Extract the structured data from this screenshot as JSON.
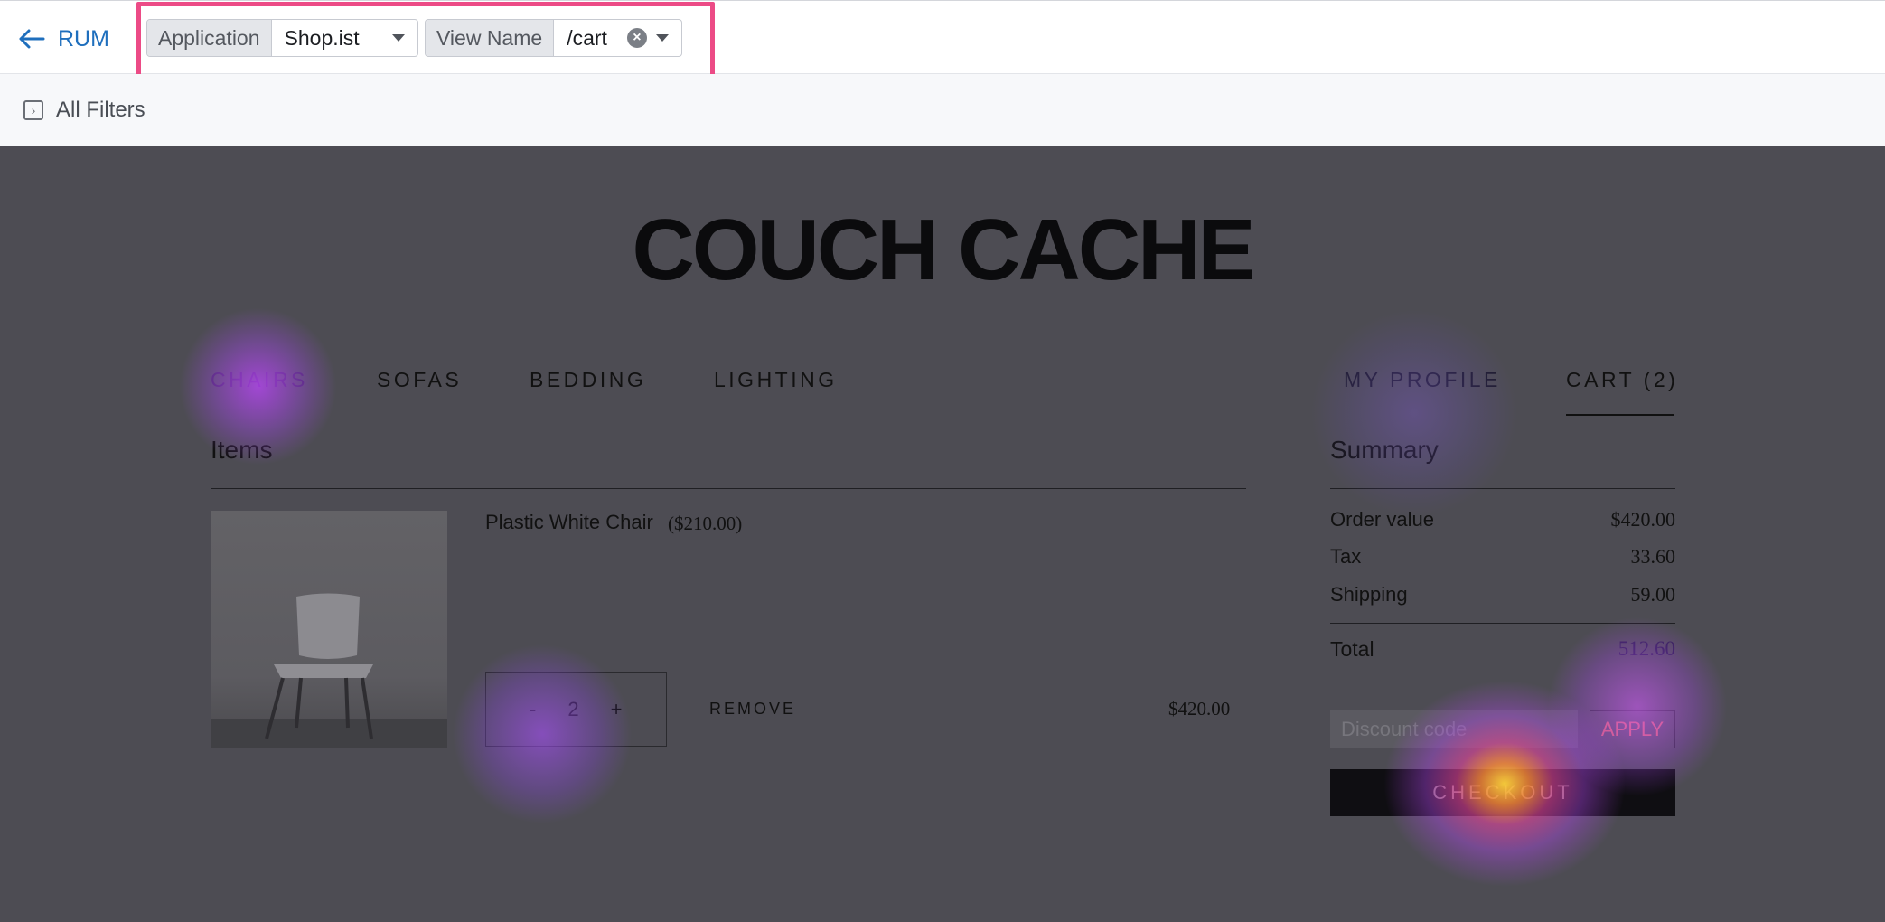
{
  "topbar": {
    "back_label": "RUM",
    "filters": [
      {
        "label": "Application",
        "value": "Shop.ist"
      },
      {
        "label": "View Name",
        "value": "/cart"
      }
    ]
  },
  "subbar": {
    "all_filters_label": "All Filters"
  },
  "site": {
    "logo": "COUCH CACHE",
    "nav_left": [
      "CHAIRS",
      "SOFAS",
      "BEDDING",
      "LIGHTING"
    ],
    "nav_right": [
      "MY PROFILE",
      "CART (2)"
    ],
    "items_heading": "Items",
    "item": {
      "name": "Plastic White Chair",
      "unit_price": "($210.00)",
      "qty_minus": "-",
      "quantity": "2",
      "qty_plus": "+",
      "remove_label": "REMOVE",
      "line_total": "$420.00"
    },
    "summary": {
      "heading": "Summary",
      "rows": [
        {
          "label": "Order value",
          "value": "$420.00"
        },
        {
          "label": "Tax",
          "value": "33.60"
        },
        {
          "label": "Shipping",
          "value": "59.00"
        }
      ],
      "total_label": "Total",
      "total_value": "512.60",
      "discount_placeholder": "Discount code",
      "apply_label": "APPLY",
      "checkout_label": "CHECKOUT"
    }
  },
  "colors": {
    "accent": "#1f6fbd",
    "highlight_border": "#ec4b86",
    "heatmap_overlay": "#4d4c53"
  }
}
